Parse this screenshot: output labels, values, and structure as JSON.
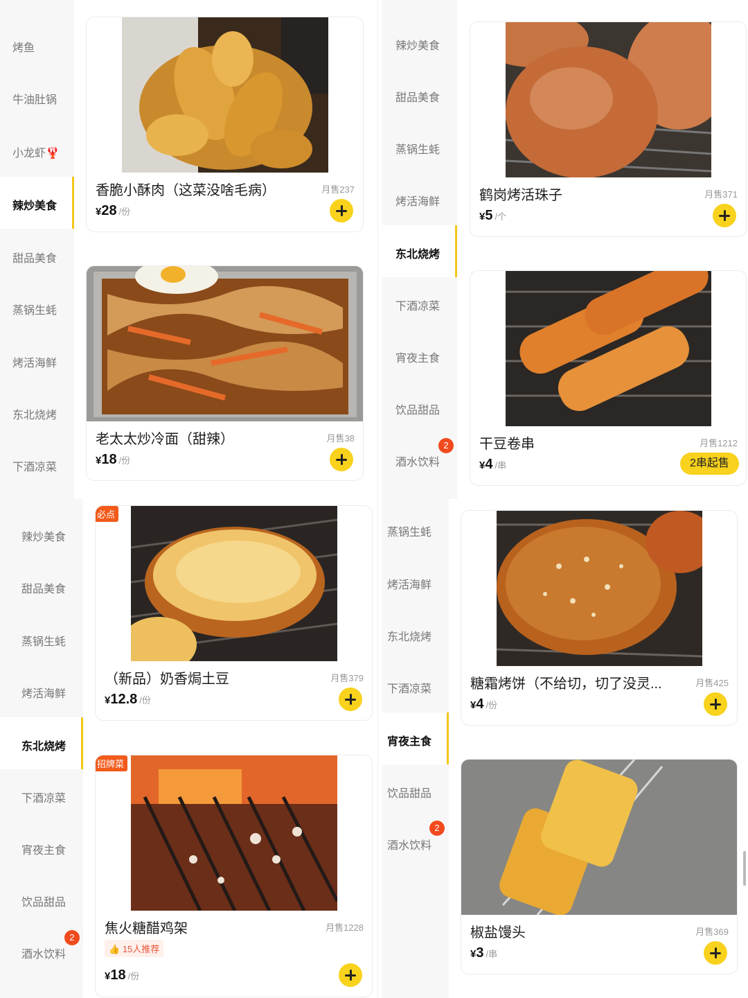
{
  "panels": {
    "tl": {
      "categories": [
        "烤鱼",
        "牛油肚锅",
        "小龙虾🦞",
        "辣炒美食",
        "甜品美食",
        "蒸锅生蚝",
        "烤活海鲜",
        "东北烧烤",
        "下酒凉菜"
      ],
      "active_index": 3,
      "items": [
        {
          "name": "香脆小酥肉（这菜没啥毛病）",
          "sales": "月售237",
          "currency": "¥",
          "price": "28",
          "unit": "/份",
          "action": "+"
        },
        {
          "name": "老太太炒冷面（甜辣）",
          "sales": "月售38",
          "currency": "¥",
          "price": "18",
          "unit": "/份",
          "action": "+"
        }
      ]
    },
    "tr": {
      "categories": [
        "辣炒美食",
        "甜品美食",
        "蒸锅生蚝",
        "烤活海鲜",
        "东北烧烤",
        "下酒凉菜",
        "宵夜主食",
        "饮品甜品",
        "酒水饮料"
      ],
      "active_index": 4,
      "badge": {
        "index": 8,
        "count": "2"
      },
      "items": [
        {
          "name": "鹤岗烤活珠子",
          "sales": "月售371",
          "currency": "¥",
          "price": "5",
          "unit": "/个",
          "action": "+"
        },
        {
          "name": "干豆卷串",
          "sales": "月售1212",
          "currency": "¥",
          "price": "4",
          "unit": "/串",
          "pill": "2串起售"
        }
      ]
    },
    "bl": {
      "categories": [
        "辣炒美食",
        "甜品美食",
        "蒸锅生蚝",
        "烤活海鲜",
        "东北烧烤",
        "下酒凉菜",
        "宵夜主食",
        "饮品甜品",
        "酒水饮料"
      ],
      "active_index": 4,
      "badge": {
        "index": 8,
        "count": "2"
      },
      "items": [
        {
          "tag": "必点",
          "name": "（新品）奶香焗土豆",
          "sales": "月售379",
          "currency": "¥",
          "price": "12.8",
          "unit": "/份",
          "action": "+"
        },
        {
          "tag": "招牌菜",
          "name": "焦火糖醋鸡架",
          "sales": "月售1228",
          "recommend": "15人推荐",
          "currency": "¥",
          "price": "18",
          "unit": "/份",
          "action": "+"
        }
      ]
    },
    "br": {
      "categories": [
        "蒸锅生蚝",
        "烤活海鲜",
        "东北烧烤",
        "下酒凉菜",
        "宵夜主食",
        "饮品甜品",
        "酒水饮料"
      ],
      "active_index": 4,
      "badge": {
        "index": 6,
        "count": "2"
      },
      "items": [
        {
          "name": "糖霜烤饼（不给切，切了没灵...",
          "sales": "月售425",
          "currency": "¥",
          "price": "4",
          "unit": "/份",
          "action": "+"
        },
        {
          "name": "椒盐馒头",
          "sales": "月售369",
          "currency": "¥",
          "price": "3",
          "unit": "/串",
          "action": "+"
        }
      ]
    }
  },
  "colors": {
    "accent": "#f8d21c",
    "badge": "#f24a1d",
    "tag": "#f25a1a"
  }
}
